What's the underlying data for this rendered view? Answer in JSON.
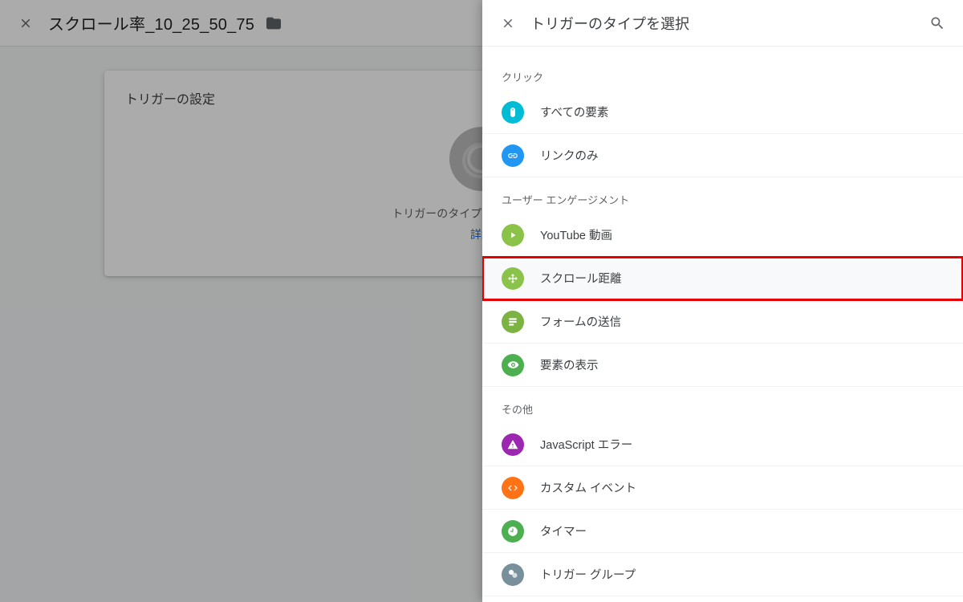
{
  "base": {
    "title": "スクロール率_10_25_50_75",
    "card_title": "トリガーの設定",
    "hint": "トリガーのタイプを選択して設定を",
    "link": "詳細"
  },
  "panel": {
    "title": "トリガーのタイプを選択",
    "sections": {
      "click_label": "クリック",
      "engagement_label": "ユーザー エンゲージメント",
      "other_label": "その他"
    },
    "items": {
      "all_elements": "すべての要素",
      "links_only": "リンクのみ",
      "youtube": "YouTube 動画",
      "scroll_depth": "スクロール距離",
      "form_submit": "フォームの送信",
      "element_visibility": "要素の表示",
      "js_error": "JavaScript エラー",
      "custom_event": "カスタム イベント",
      "timer": "タイマー",
      "trigger_group": "トリガー グループ"
    }
  }
}
